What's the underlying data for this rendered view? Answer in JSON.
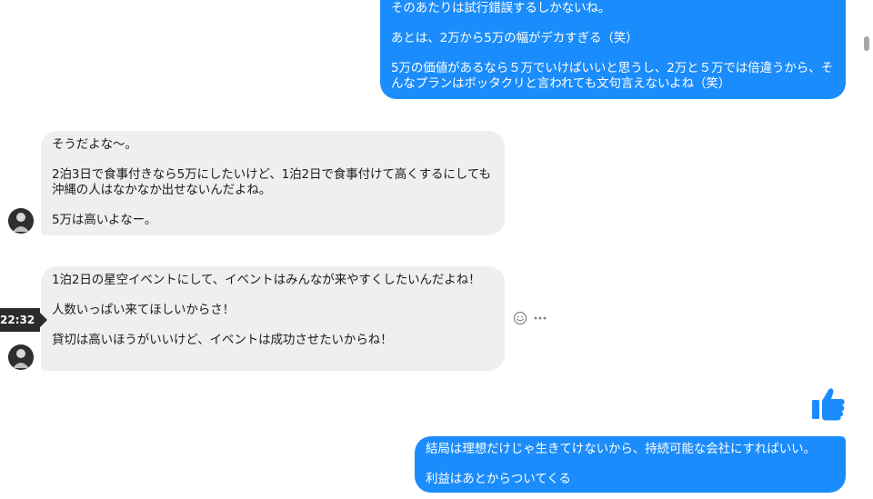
{
  "colors": {
    "outgoing_bubble": "#1b8cfb",
    "incoming_bubble": "#efefef",
    "like_icon": "#1b8cfb"
  },
  "messages": [
    {
      "direction": "outgoing",
      "text": "そのあたりは試行錯誤するしかないね。\n\nあとは、2万から5万の幅がデカすぎる（笑）\n\n5万の価値があるなら５万でいけばいいと思うし、2万と５万では倍違うから、そんなプランはボッタクリと言われても文句言えないよね（笑）"
    },
    {
      "direction": "incoming",
      "text": "そうだよな〜。\n\n2泊3日で食事付きなら5万にしたいけど、1泊2日で食事付けて高くするにしても沖縄の人はなかなか出せないんだよね。\n\n5万は高いよなー。"
    },
    {
      "direction": "incoming",
      "text": "1泊2日の星空イベントにして、イベントはみんなが来やすくしたいんだよね！\n\n人数いっぱい来てほしいからさ！\n\n貸切は高いほうがいいけど、イベントは成功させたいからね！"
    },
    {
      "direction": "outgoing",
      "text": "結局は理想だけじゃ生きてけないから、持続可能な会社にすればいい。\n\n利益はあとからついてくる"
    }
  ],
  "timestamp": "22:32",
  "icons": {
    "emoji": "smiley-icon",
    "more": "more-options-icon",
    "like": "thumbs-up-icon",
    "avatar": "avatar"
  }
}
